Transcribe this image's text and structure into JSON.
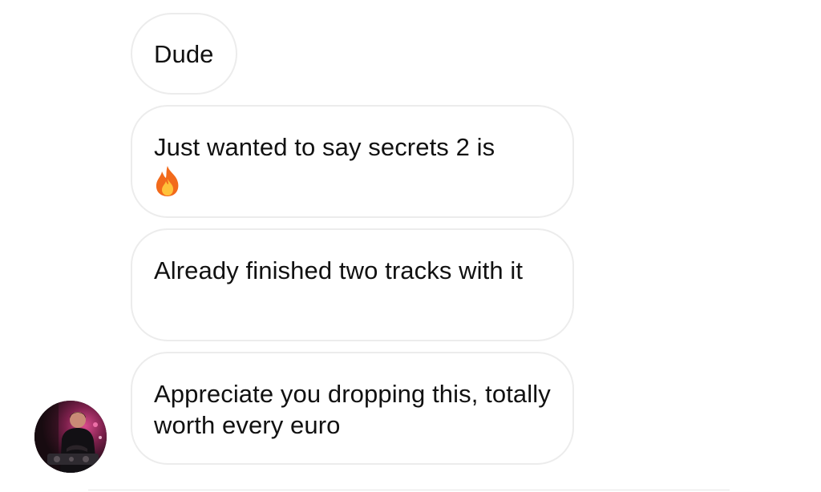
{
  "chat": {
    "messages": [
      {
        "text": "Dude"
      },
      {
        "text": "Just wanted to say secrets 2 is",
        "emoji": "fire-emoji"
      },
      {
        "text": "Already finished two tracks with it"
      },
      {
        "text": "Appreciate you dropping this, totally worth every euro"
      }
    ],
    "sender_avatar": {
      "icon": "dj-profile-photo"
    }
  }
}
